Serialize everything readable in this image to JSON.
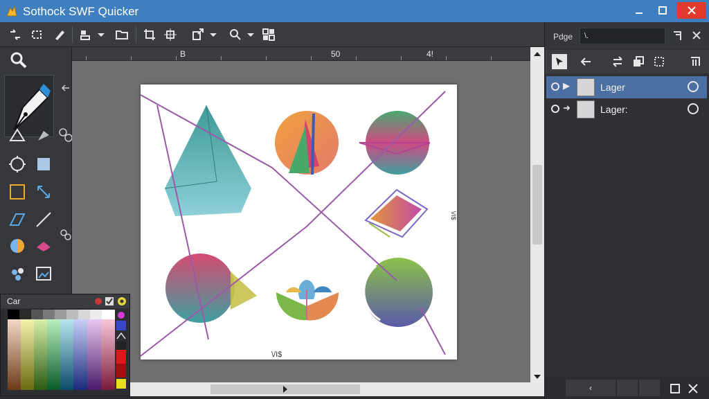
{
  "window": {
    "title": "Sothock SWF Quicker"
  },
  "ruler": {
    "labels": [
      "B",
      "50",
      "4!"
    ]
  },
  "canvas": {
    "bottom_label": "\\/I$",
    "side_label": "\\/I$"
  },
  "color_panel": {
    "label": "Car"
  },
  "right_panel": {
    "doc_label": "Pdge",
    "doc_field_value": "\\.",
    "layers": [
      {
        "name": "Lager",
        "selected": true
      },
      {
        "name": "Lager:",
        "selected": false
      }
    ],
    "footer": {
      "prev": "‹"
    }
  },
  "colors": {
    "title_bar": "#3f7fc0",
    "close_button": "#e23b2e",
    "selected_layer": "#4b6fa3",
    "canvas_bg": "#6e6f71"
  }
}
